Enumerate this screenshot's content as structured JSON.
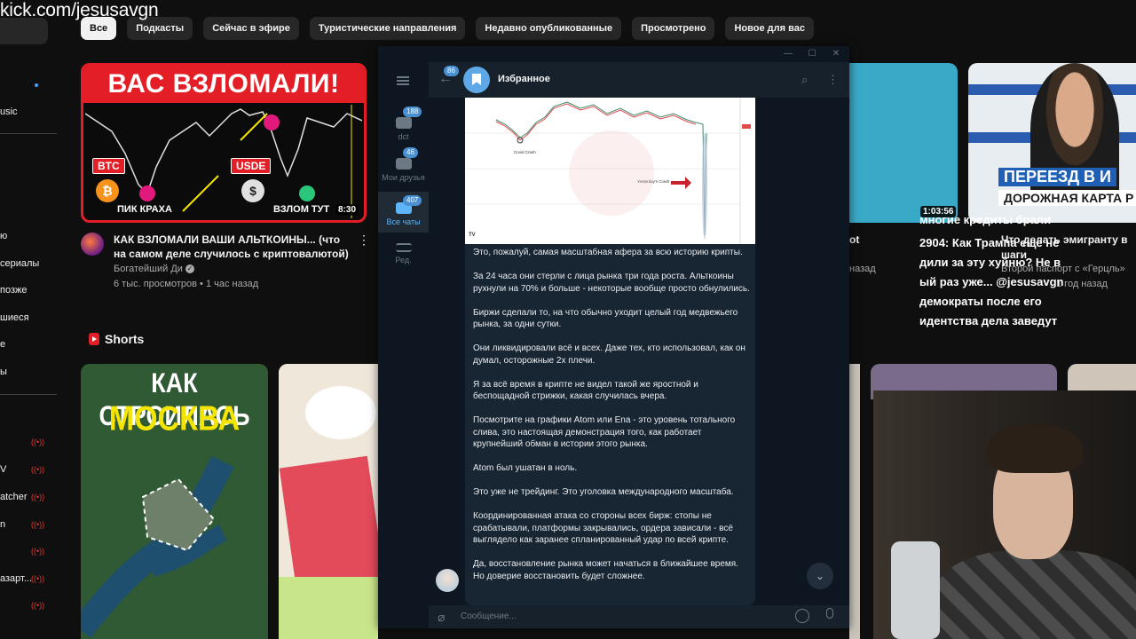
{
  "watermark": "kick.com/jesusavgn",
  "chips": [
    "Все",
    "Подкасты",
    "Сейчас в эфире",
    "Туристические направления",
    "Недавно опубликованные",
    "Просмотрено",
    "Новое для вас"
  ],
  "sidebar": {
    "items": [
      "usic",
      "",
      "",
      "ю",
      "сериалы",
      "позже",
      "шиеся",
      "е",
      "ы",
      "V",
      "atcher",
      "n",
      "азарт...",
      "",
      ""
    ]
  },
  "video1": {
    "thumb_banner": "ВАС ВЗЛОМАЛИ!",
    "thumb_labels": [
      "BTC",
      "USDE",
      "ПИК КРАХА",
      "ВЗЛОМ ТУТ",
      "ПИК КРАХА"
    ],
    "duration": "8:30",
    "title": "КАК ВЗЛОМАЛИ ВАШИ АЛЬТКОИНЫ... (что на самом деле случилось с криптовалютой)",
    "channel": "Богатейший Ди",
    "meta": "6 тыс. просмотров • 1 час назад"
  },
  "shorts": {
    "heading": "Shorts",
    "short1_line1": "КАК СТРОИЛАСЬ",
    "short1_line2": "МОСКВА"
  },
  "right": {
    "thumb2_title": "ПЕРЕЕЗД В И",
    "thumb2_sub": "ДОРОЖНАЯ КАРТА Р",
    "duration2": "1:03:56",
    "info_ot": "ot",
    "info_nazad": "назад",
    "info_lines": [
      "Что делать эмигранту в",
      "шаги",
      "Второй паспорт с «Герцль»",
      "1 год назад"
    ],
    "chat_overlay": [
      "многие кредиты брали",
      "2904: Как Трампа еще не",
      "дили за эту хуйню? Не в",
      "ый раз уже... @jesusavgn",
      " демократы после его",
      "идентства дела заведут"
    ]
  },
  "telegram": {
    "chat_title": "Избранное",
    "back_count": "86",
    "folders": [
      {
        "label": "dct",
        "count": "188"
      },
      {
        "label": "Мои друзья",
        "count": "46"
      },
      {
        "label": "Все чаты",
        "count": "407"
      },
      {
        "label": "Ред.",
        "count": ""
      }
    ],
    "chart_labels": {
      "covid": "Covid Crash",
      "yesterday": "Yesterday's Crash"
    },
    "message_paragraphs": [
      "Это, пожалуй, самая масштабная афера за всю историю крипты.",
      "За 24 часа они стерли с лица рынка три года роста. Альткоины рухнули на 70% и больше - некоторые вообще просто обнулились.",
      "Биржи сделали то, на что обычно уходит целый год медвежьего рынка, за одни сутки.",
      "Они ликвидировали всё и всех. Даже тех, кто использовал, как он думал, осторожные 2х плечи.",
      "Я за всё время в крипте не видел такой же яростной и беспощадной стрижки, какая случилась вчера.",
      "Посмотрите на графики Atom или Ena - это уровень тотального слива, это настоящая демонстрация того, как работает крупнейший обман в истории этого рынка.",
      "Atom был ушатан в ноль.",
      "Это уже не трейдинг. Это уголовка международного масштаба.",
      "Координированная атака со стороны всех бирж: стопы не срабатывали, платформы закрывались, ордера зависали - всё выглядело как заранее спланированный удар по всей крипте.",
      "Да, восстановление рынка может начаться в ближайшее время. Но доверие восстановить будет сложнее."
    ],
    "composer_placeholder": "Сообщение..."
  },
  "colors": {
    "accent_red": "#e41e26",
    "tg_bg": "#17212b",
    "tg_accent": "#5eb5f7"
  }
}
